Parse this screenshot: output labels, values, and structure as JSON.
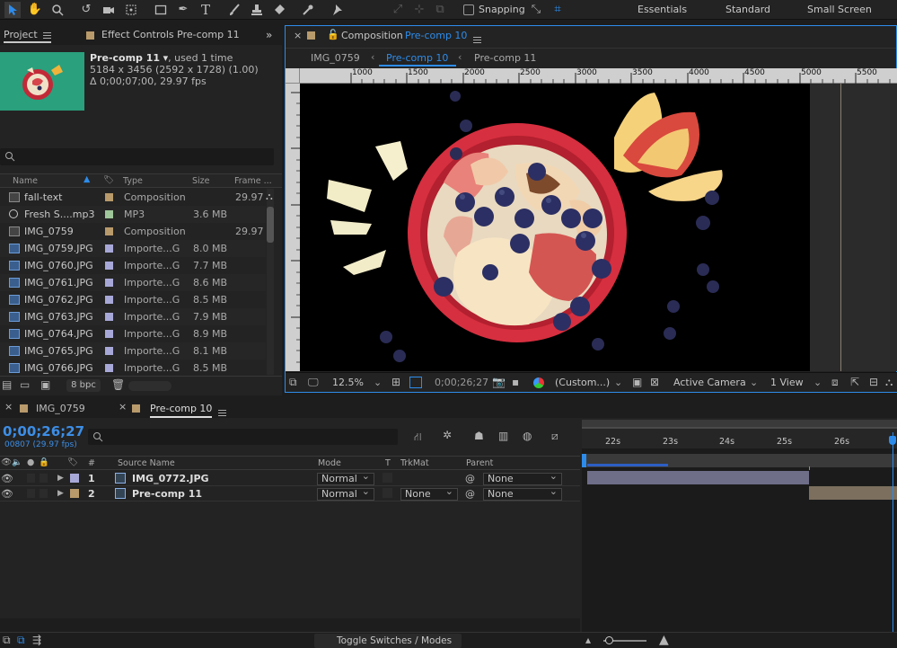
{
  "toolbar": {
    "snapping_label": "Snapping",
    "workspaces": [
      "Essentials",
      "Standard",
      "Small Screen"
    ]
  },
  "project": {
    "tab_project": "Project",
    "tab_effects": "Effect Controls Pre-comp 11",
    "item_name": "Pre-comp 11",
    "item_used": ", used 1 time",
    "item_dims": "5184 x 3456  (2592 x 1728) (1.00)",
    "item_duration": "Δ 0;00;07;00, 29.97 fps",
    "columns": [
      "Name",
      "Type",
      "Size",
      "Frame ..."
    ],
    "rows": [
      {
        "name": "fall-text",
        "type": "Composition",
        "size": "",
        "frame": "29.97",
        "icon": "composition-icon",
        "label_color": "#b89a6b"
      },
      {
        "name": "Fresh S....mp3",
        "type": "MP3",
        "size": "3.6 MB",
        "frame": "",
        "icon": "audio-icon",
        "label_color": "#9fc59a"
      },
      {
        "name": "IMG_0759",
        "type": "Composition",
        "size": "",
        "frame": "29.97",
        "icon": "composition-icon",
        "label_color": "#b89a6b"
      },
      {
        "name": "IMG_0759.JPG",
        "type": "Importe...G",
        "size": "8.0 MB",
        "frame": "",
        "icon": "image-icon",
        "label_color": "#a8a8d8"
      },
      {
        "name": "IMG_0760.JPG",
        "type": "Importe...G",
        "size": "7.7 MB",
        "frame": "",
        "icon": "image-icon",
        "label_color": "#a8a8d8"
      },
      {
        "name": "IMG_0761.JPG",
        "type": "Importe...G",
        "size": "8.6 MB",
        "frame": "",
        "icon": "image-icon",
        "label_color": "#a8a8d8"
      },
      {
        "name": "IMG_0762.JPG",
        "type": "Importe...G",
        "size": "8.5 MB",
        "frame": "",
        "icon": "image-icon",
        "label_color": "#a8a8d8"
      },
      {
        "name": "IMG_0763.JPG",
        "type": "Importe...G",
        "size": "7.9 MB",
        "frame": "",
        "icon": "image-icon",
        "label_color": "#a8a8d8"
      },
      {
        "name": "IMG_0764.JPG",
        "type": "Importe...G",
        "size": "8.9 MB",
        "frame": "",
        "icon": "image-icon",
        "label_color": "#a8a8d8"
      },
      {
        "name": "IMG_0765.JPG",
        "type": "Importe...G",
        "size": "8.1 MB",
        "frame": "",
        "icon": "image-icon",
        "label_color": "#a8a8d8"
      },
      {
        "name": "IMG_0766.JPG",
        "type": "Importe...G",
        "size": "8.5 MB",
        "frame": "",
        "icon": "image-icon",
        "label_color": "#a8a8d8"
      }
    ],
    "bpc": "8 bpc"
  },
  "viewer": {
    "tab_prefix": "Composition",
    "tab_comp": "Pre-comp 10",
    "breadcrumbs": [
      "IMG_0759",
      "Pre-comp 10",
      "Pre-comp 11"
    ],
    "ruler_labels": [
      "1000",
      "1500",
      "2000",
      "2500",
      "3000",
      "3500",
      "4000",
      "4500",
      "5000",
      "5500"
    ],
    "zoom": "12.5%",
    "timecode": "0;00;26;27",
    "resolution": "(Custom...)",
    "camera": "Active Camera",
    "views": "1 View"
  },
  "timeline": {
    "tabs": [
      "IMG_0759",
      "Pre-comp 10"
    ],
    "timecode": "0;00;26;27",
    "frames": "00807 (29.97 fps)",
    "columns": [
      "#",
      "Source Name",
      "Mode",
      "T",
      "TrkMat",
      "Parent"
    ],
    "layers": [
      {
        "num": "1",
        "name": "IMG_0772.JPG",
        "mode": "Normal",
        "trkmat": "",
        "parent": "None",
        "label_color": "#a8a8d8"
      },
      {
        "num": "2",
        "name": "Pre-comp 11",
        "mode": "Normal",
        "trkmat": "None",
        "parent": "None",
        "label_color": "#b89a6b"
      }
    ],
    "time_labels": [
      "22s",
      "23s",
      "24s",
      "25s",
      "26s"
    ],
    "toggle_label": "Toggle Switches / Modes"
  },
  "colors": {
    "accent": "#2d8ceb",
    "canvas": "#000000",
    "bowl": "#d62f3f",
    "thumb_bg": "#2aa07c"
  }
}
